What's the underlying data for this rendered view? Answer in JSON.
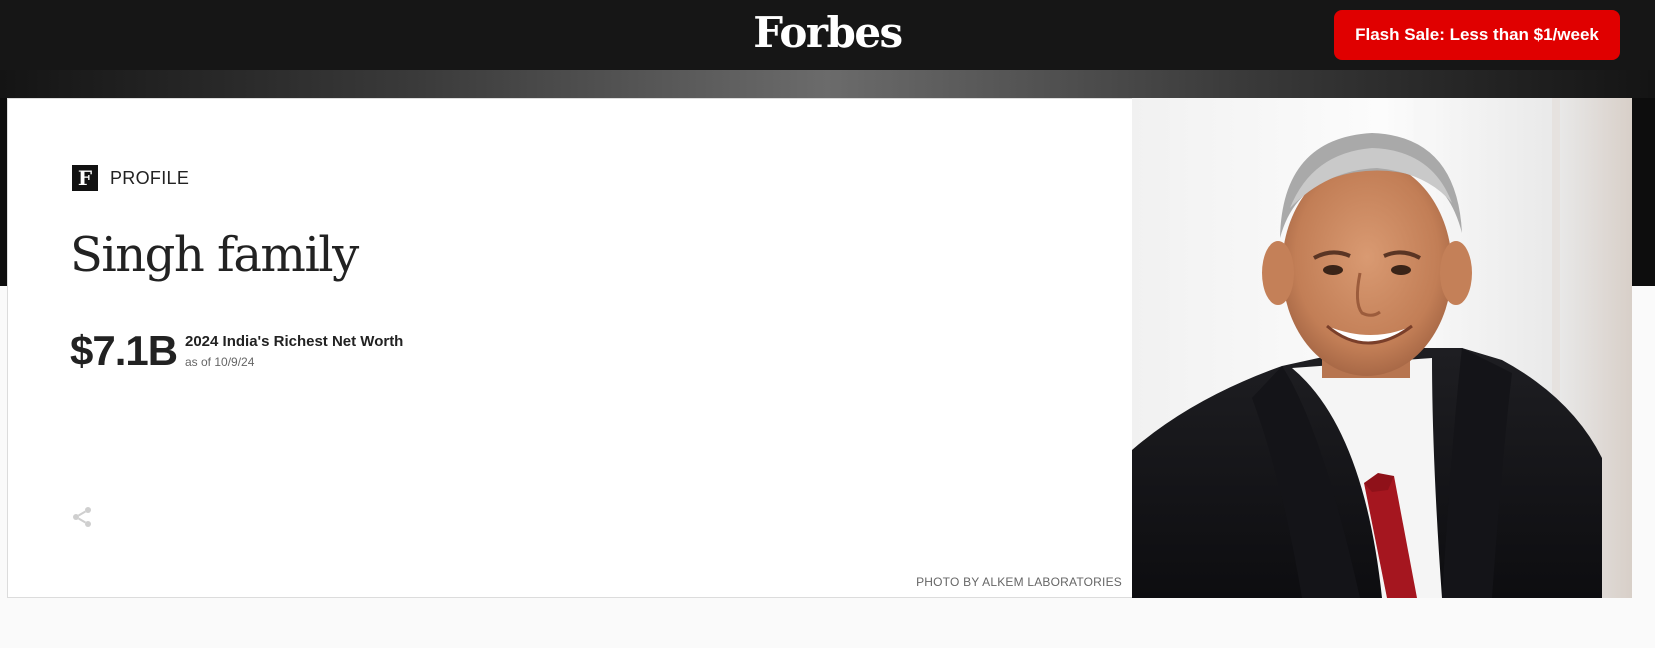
{
  "header": {
    "logo": "Forbes",
    "flash_sale_label": "Flash Sale: Less than $1/week",
    "flash_sale_color": "#e00000"
  },
  "profile": {
    "badge_letter": "F",
    "section_label": "PROFILE",
    "name": "Singh family",
    "net_worth": "$7.1B",
    "net_worth_title": "2024 India's Richest Net Worth",
    "net_worth_date": "as of 10/9/24",
    "share_icon": "share-icon",
    "photo_credit": "PHOTO BY ALKEM LABORATORIES"
  }
}
